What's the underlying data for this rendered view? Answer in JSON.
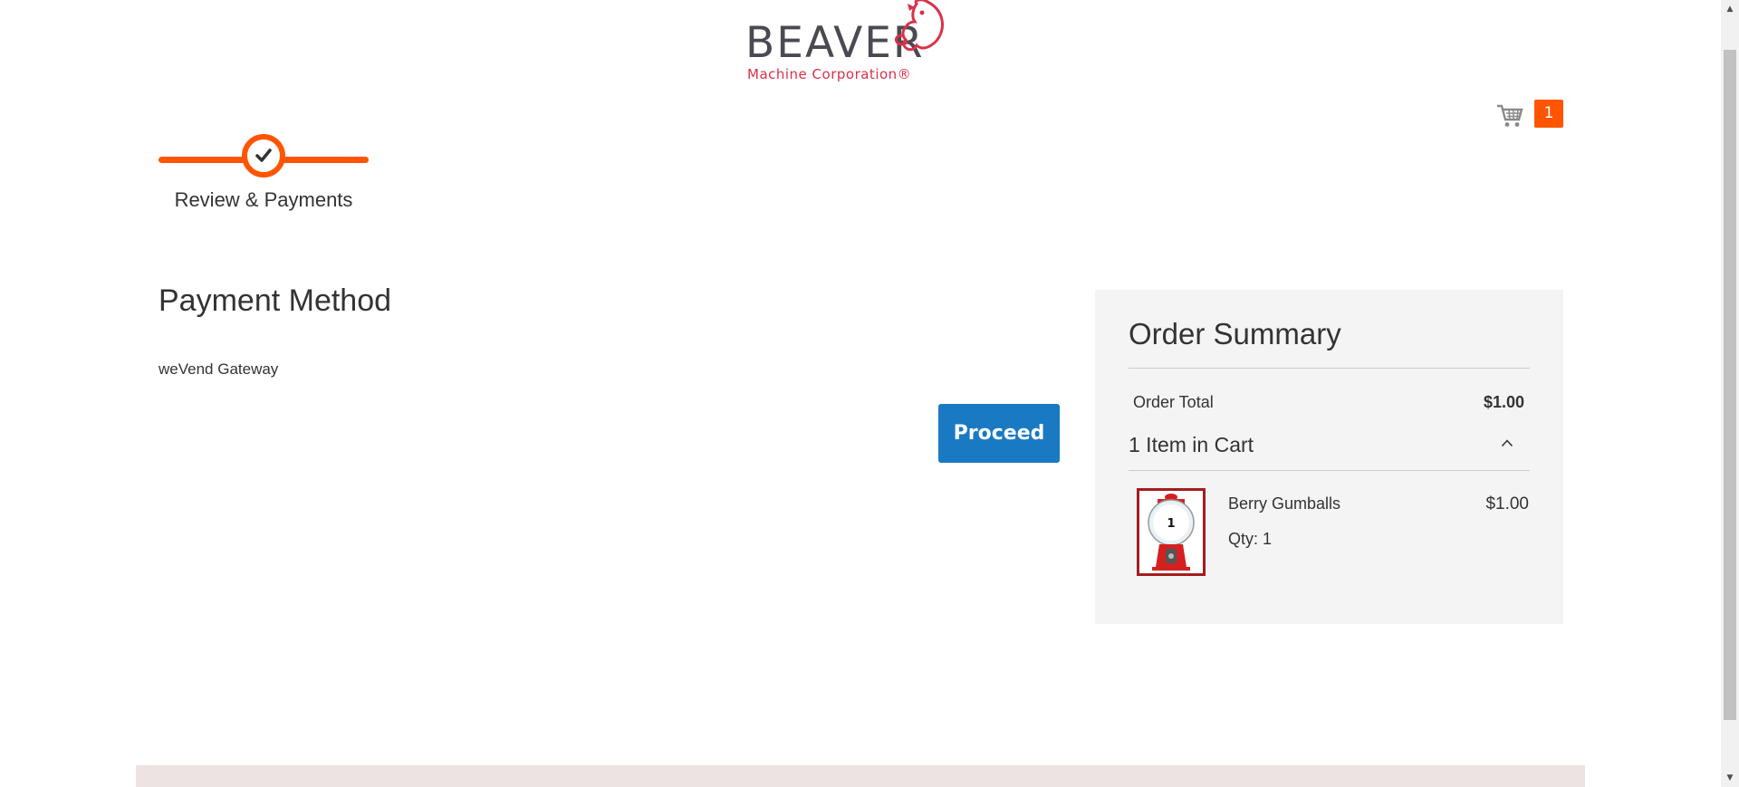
{
  "header": {
    "logo_word": "BEAVER",
    "logo_sub": "Machine Corporation®",
    "logo_color": "#d9314a"
  },
  "cart": {
    "icon": "shopping-cart-icon",
    "count": "1",
    "badge_color": "#ff5501"
  },
  "progress": {
    "step_label": "Review & Payments",
    "icon": "check-icon",
    "accent": "#ff5501"
  },
  "payment": {
    "title": "Payment Method",
    "method_name": "weVend Gateway",
    "proceed_label": "Proceed",
    "button_color": "#1979c3"
  },
  "summary": {
    "title": "Order Summary",
    "total_label": "Order Total",
    "total_value": "$1.00",
    "items_label": "1 Item in Cart",
    "chevron": "chevron-up-icon",
    "items": [
      {
        "name": "Berry Gumballs",
        "price": "$1.00",
        "qty_label": "Qty: 1",
        "thumb_number": "1"
      }
    ]
  }
}
